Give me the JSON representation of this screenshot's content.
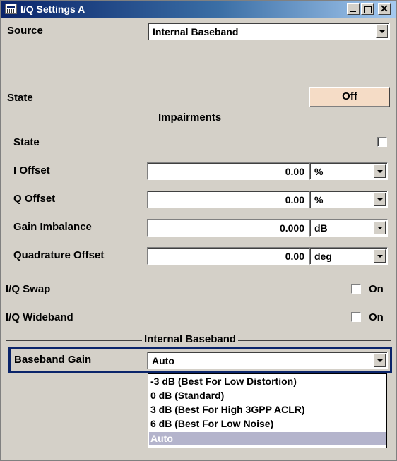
{
  "window": {
    "title": "I/Q Settings A"
  },
  "source": {
    "label": "Source",
    "value": "Internal Baseband"
  },
  "state": {
    "label": "State",
    "button_label": "Off"
  },
  "impairments": {
    "group_title": "Impairments",
    "state_label": "State",
    "state_checked": false,
    "rows": [
      {
        "label": "I Offset",
        "value": "0.00",
        "unit": "%"
      },
      {
        "label": "Q Offset",
        "value": "0.00",
        "unit": "%"
      },
      {
        "label": "Gain Imbalance",
        "value": "0.000",
        "unit": "dB"
      },
      {
        "label": "Quadrature Offset",
        "value": "0.00",
        "unit": "deg"
      }
    ]
  },
  "iq_swap": {
    "label": "I/Q Swap",
    "check_label": "On",
    "checked": false
  },
  "iq_wideband": {
    "label": "I/Q Wideband",
    "check_label": "On",
    "checked": false
  },
  "internal_baseband": {
    "group_title": "Internal Baseband",
    "gain_label": "Baseband Gain",
    "gain_value": "Auto",
    "options": [
      "-3 dB (Best For Low Distortion)",
      "0 dB (Standard)",
      "3 dB (Best For High 3GPP ACLR)",
      "6 dB (Best For Low Noise)",
      "Auto"
    ],
    "selected_index": 4
  },
  "colors": {
    "titlebar_start": "#0a246a",
    "titlebar_end": "#a6caf0",
    "panel": "#d4d0c8",
    "state_button": "#f5dcc6",
    "focus_border": "#0a246a",
    "selected_option": "#b4b4cc"
  }
}
